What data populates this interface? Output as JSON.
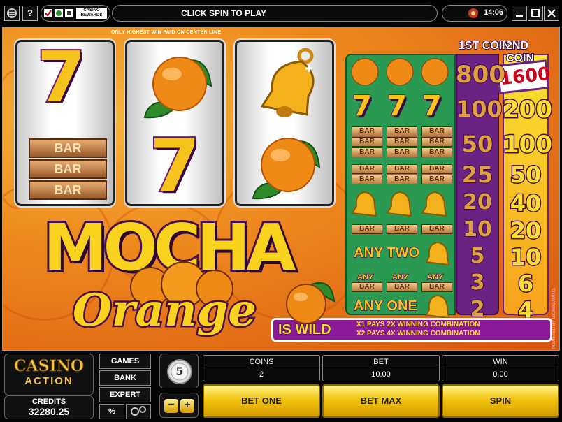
{
  "toolbar": {
    "menu_icon": "menu-icon",
    "help_label": "?",
    "rewards_label": "CASINO REWARDS",
    "status": "CLICK SPIN TO PLAY",
    "time": "14:06"
  },
  "reels": {
    "payline_note": "ONLY HIGHEST WIN PAID ON CENTER LINE",
    "reel1": [
      "seven",
      "bar3"
    ],
    "reel2": [
      "orange",
      "seven"
    ],
    "reel3": [
      "bell",
      "orange"
    ],
    "bar_label": "BAR"
  },
  "logo": {
    "line1": "MOCHA",
    "line2": "Orange"
  },
  "paytable": {
    "head1": "1ST COIN",
    "head2": "2ND COIN",
    "col1": [
      "800",
      "100",
      "50",
      "25",
      "20",
      "10",
      "5",
      "3",
      "2"
    ],
    "col2": [
      "1600",
      "200",
      "100",
      "50",
      "40",
      "20",
      "10",
      "6",
      "4"
    ],
    "any_two": "ANY TWO",
    "any_one": "ANY ONE",
    "any": "ANY",
    "bar": "BAR"
  },
  "wild": {
    "is_wild": "IS WILD",
    "line1": "X1 PAYS 2X WINNING COMBINATION",
    "line2": "X2 PAYS 4X WINNING COMBINATION",
    "credit": "POWERED BY MICROGAMING"
  },
  "brand": {
    "line1": "CASINO",
    "line2": "ACTION"
  },
  "credits": {
    "label": "CREDITS",
    "value": "32280.25"
  },
  "menu": {
    "games": "GAMES",
    "bank": "BANK",
    "expert": "EXPERT",
    "percent": "%"
  },
  "coin_size": "5",
  "coins": {
    "label": "COINS",
    "value": "2"
  },
  "bet": {
    "label": "BET",
    "value": "10.00"
  },
  "win": {
    "label": "WIN",
    "value": "0.00"
  },
  "buttons": {
    "bet_one": "BET ONE",
    "bet_max": "BET MAX",
    "spin": "SPIN"
  }
}
